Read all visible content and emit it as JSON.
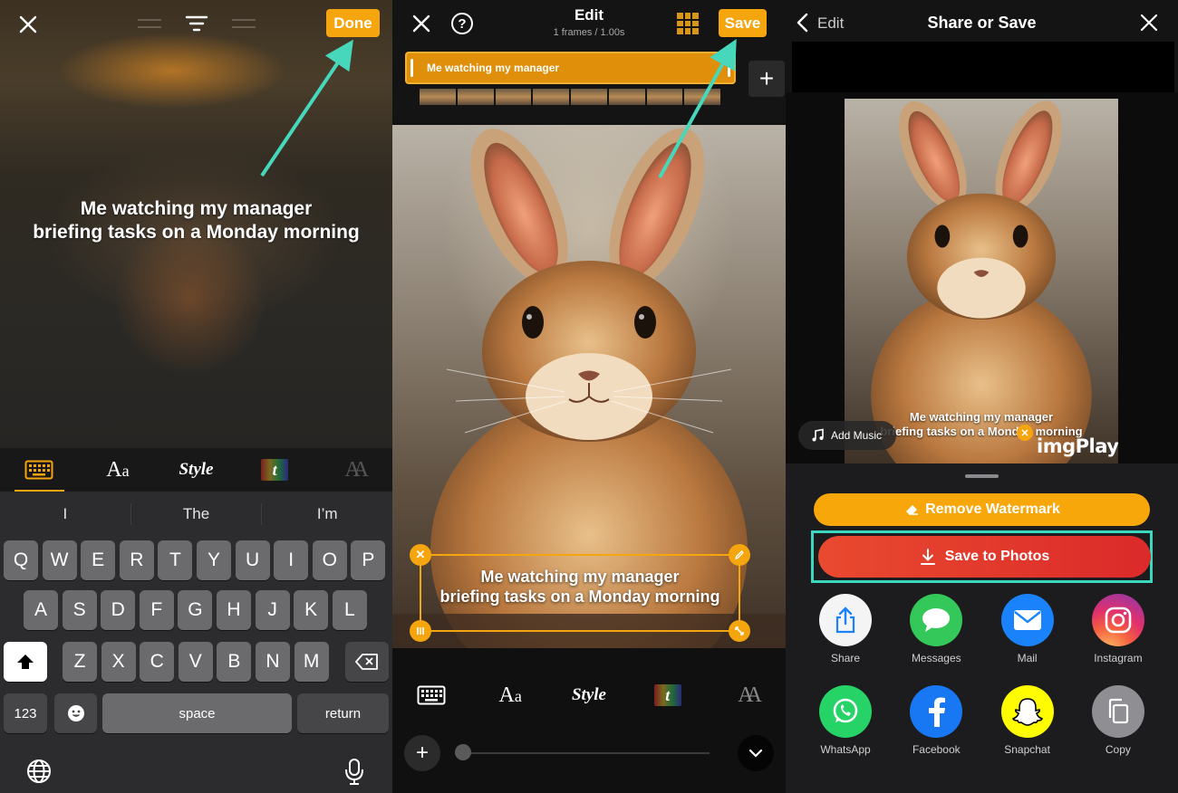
{
  "panel1": {
    "done_label": "Done",
    "caption_line1": "Me watching my manager",
    "caption_line2": "briefing tasks on a Monday morning",
    "tabs": {
      "aa": "A",
      "aa_small": "a",
      "style": "Style",
      "t": "t",
      "faded": "AA"
    },
    "suggestions": [
      "I",
      "The",
      "I’m"
    ],
    "keys_row1": [
      "Q",
      "W",
      "E",
      "R",
      "T",
      "Y",
      "U",
      "I",
      "O",
      "P"
    ],
    "keys_row2": [
      "A",
      "S",
      "D",
      "F",
      "G",
      "H",
      "J",
      "K",
      "L"
    ],
    "keys_row3": [
      "Z",
      "X",
      "C",
      "V",
      "B",
      "N",
      "M"
    ],
    "key_123": "123",
    "key_space": "space",
    "key_return": "return"
  },
  "panel2": {
    "title": "Edit",
    "subtitle": "1 frames / 1.00s",
    "help": "?",
    "save_label": "Save",
    "track_label": "Me watching my manager",
    "add_track": "+",
    "caption_line1": "Me watching my manager",
    "caption_line2": "briefing tasks on a Monday morning",
    "tabs": {
      "aa": "A",
      "aa_small": "a",
      "style": "Style",
      "t": "t",
      "faded": "AA"
    },
    "add_button": "+",
    "slider_fraction": 0.0
  },
  "panel3": {
    "back_label": "Edit",
    "title": "Share or Save",
    "caption_line1": "Me watching my manager",
    "caption_line2": "briefing tasks on a Monday morning",
    "watermark": "imgPlay",
    "add_music": "Add Music",
    "remove_watermark": "Remove Watermark",
    "save_to_photos": "Save to Photos",
    "share_targets": [
      {
        "label": "Share",
        "icon": "share-icon",
        "color": "#f4f4f4"
      },
      {
        "label": "Messages",
        "icon": "messages-icon",
        "color": "#34c759"
      },
      {
        "label": "Mail",
        "icon": "mail-icon",
        "color": "#1a82fb"
      },
      {
        "label": "Instagram",
        "icon": "instagram-icon",
        "color": "#e1306c"
      },
      {
        "label": "WhatsApp",
        "icon": "whatsapp-icon",
        "color": "#25d366"
      },
      {
        "label": "Facebook",
        "icon": "facebook-icon",
        "color": "#1877f2"
      },
      {
        "label": "Snapchat",
        "icon": "snapchat-icon",
        "color": "#fffc00"
      },
      {
        "label": "Copy",
        "icon": "copy-icon",
        "color": "#8e8e93"
      }
    ]
  },
  "colors": {
    "accent": "#f5a50d",
    "highlight": "#3cd7bf",
    "save_red": "#e33a2c"
  }
}
